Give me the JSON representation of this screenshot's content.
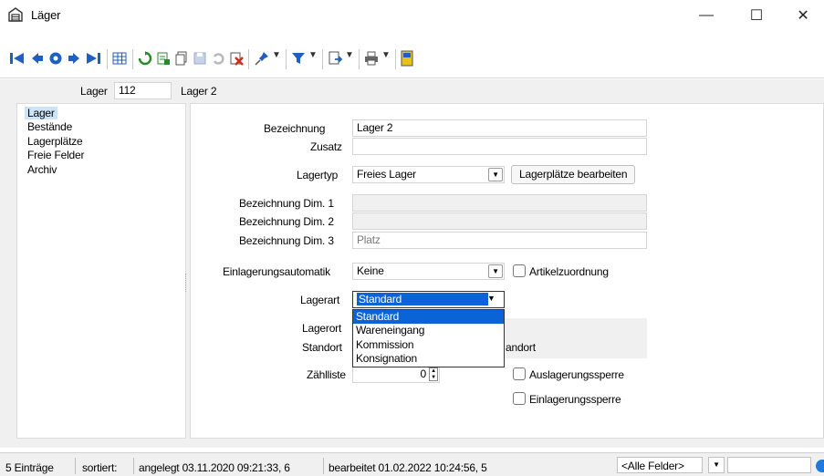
{
  "window": {
    "title": "Läger",
    "minimize": "—",
    "maximize": "☐",
    "close": "✕"
  },
  "header": {
    "lager_label": "Lager",
    "lager_value": "112",
    "lager_name": "Lager 2"
  },
  "nav": {
    "items": [
      "Lager",
      "Bestände",
      "Lagerplätze",
      "Freie Felder",
      "Archiv"
    ],
    "selected": "Lager"
  },
  "form": {
    "bezeichnung_label": "Bezeichnung",
    "bezeichnung_value": "Lager 2",
    "zusatz_label": "Zusatz",
    "zusatz_value": "",
    "lagertyp_label": "Lagertyp",
    "lagertyp_value": "Freies Lager",
    "lagerplaetze_button": "Lagerplätze bearbeiten",
    "dim1_label": "Bezeichnung Dim. 1",
    "dim1_value": "",
    "dim2_label": "Bezeichnung Dim. 2",
    "dim2_value": "",
    "dim3_label": "Bezeichnung Dim. 3",
    "dim3_value": "Platz",
    "einlagerung_label": "Einlagerungsautomatik",
    "einlagerung_value": "Keine",
    "artikelzuordnung_label": "Artikelzuordnung",
    "lagerart_label": "Lagerart",
    "lagerart_value": "Standard",
    "lagerart_options": [
      "Standard",
      "Wareneingang",
      "Kommission",
      "Konsignation"
    ],
    "lagerort_label": "Lagerort",
    "standort_label": "Standort",
    "standort_suffix": "andort",
    "zaehlliste_label": "Zählliste",
    "zaehlliste_value": "0",
    "auslagerungssperre_label": "Auslagerungssperre",
    "einlagerungssperre_label": "Einlagerungssperre"
  },
  "status": {
    "count": "5 Einträge",
    "sorted": "sortiert:",
    "created": "angelegt 03.11.2020 09:21:33,  6",
    "edited": "bearbeitet 01.02.2022 10:24:56,  5",
    "filter": "<Alle Felder>"
  },
  "colors": {
    "accent_blue": "#0a64d8",
    "nav_selected": "#cce4f7",
    "toolbar_blue": "#1f5fc4",
    "toolbar_green": "#2a8a2a",
    "toolbar_red": "#d42a1a"
  }
}
